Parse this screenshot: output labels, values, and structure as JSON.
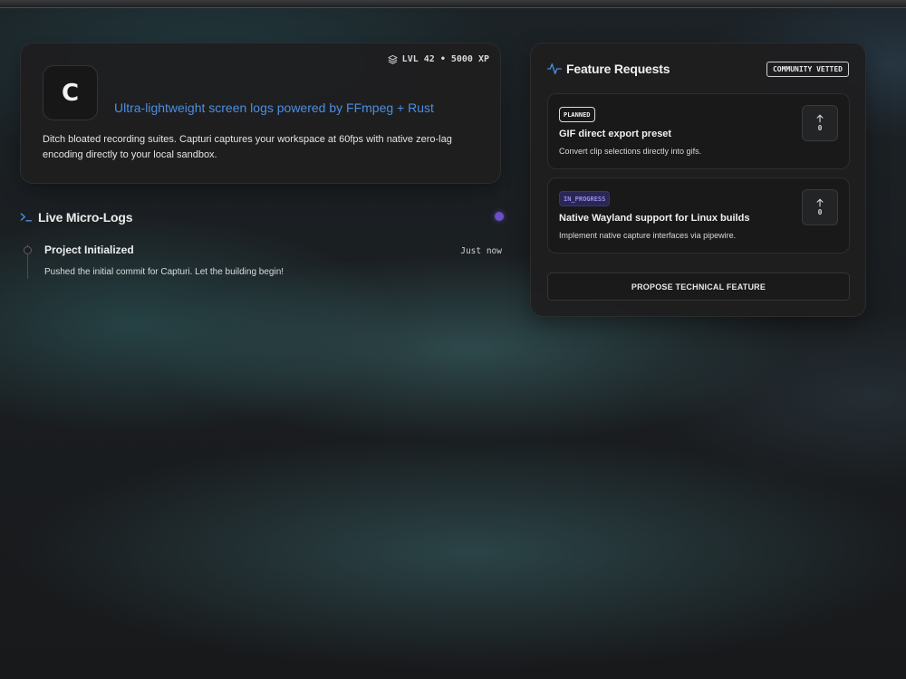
{
  "hero": {
    "logo_letter": "C",
    "level": "LVL 42 • 5000 XP",
    "tagline": "Ultra-lightweight screen logs powered by FFmpeg + Rust",
    "description": "Ditch bloated recording suites. Capturi captures your workspace at 60fps with native zero-lag encoding directly to your local sandbox."
  },
  "logs": {
    "title": "Live Micro-Logs",
    "items": [
      {
        "title": "Project Initialized",
        "time": "Just now",
        "description": "Pushed the initial commit for Capturi. Let the building begin!"
      }
    ]
  },
  "features": {
    "title": "Feature Requests",
    "badge": "COMMUNITY VETTED",
    "requests": [
      {
        "status": "PLANNED",
        "title": "GIF direct export preset",
        "description": "Convert clip selections directly into gifs.",
        "votes": "0"
      },
      {
        "status": "IN_PROGRESS",
        "title": "Native Wayland support for Linux builds",
        "description": "Implement native capture interfaces via pipewire.",
        "votes": "0"
      }
    ],
    "propose_label": "PROPOSE TECHNICAL FEATURE"
  },
  "colors": {
    "accent_blue": "#4c8ee0",
    "live_dot": "#6b4fc7",
    "in_progress": "#9a8cf0"
  },
  "icons": {
    "level": "layers-icon",
    "logs": "terminal-icon",
    "features": "activity-pulse-icon",
    "vote": "arrow-up-icon"
  }
}
